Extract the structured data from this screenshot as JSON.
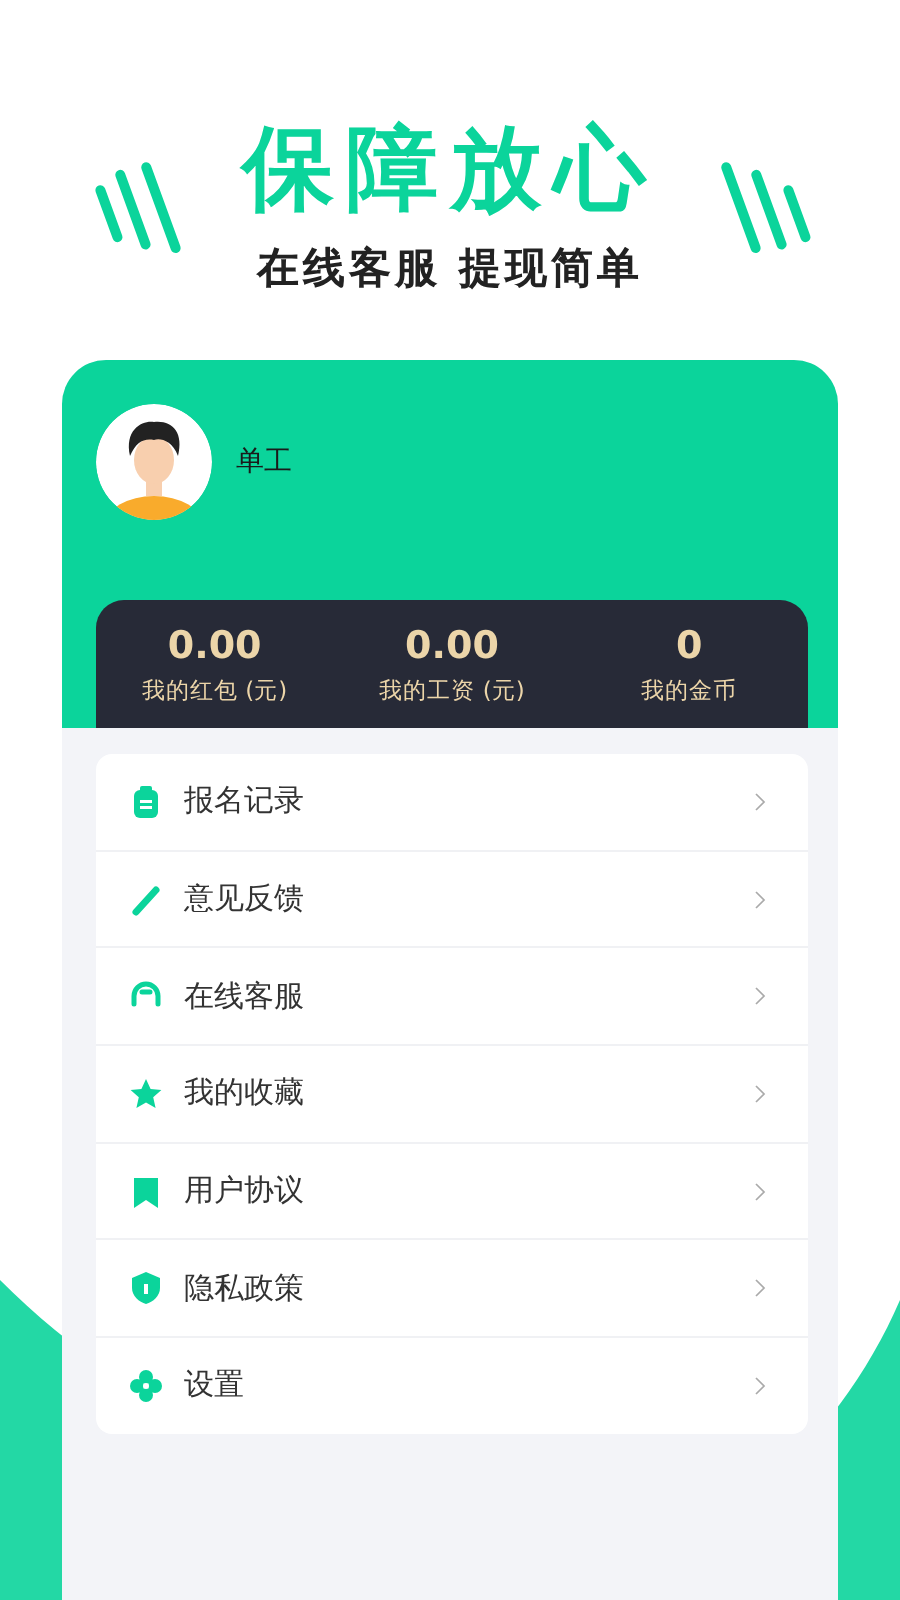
{
  "promo": {
    "headline": "保障放心",
    "subtitle": "在线客服 提现简单"
  },
  "profile": {
    "name": "单工"
  },
  "stats": [
    {
      "value": "0.00",
      "label": "我的红包 (元)"
    },
    {
      "value": "0.00",
      "label": "我的工资 (元)"
    },
    {
      "value": "0",
      "label": "我的金币"
    }
  ],
  "menu": [
    {
      "label": "报名记录"
    },
    {
      "label": "意见反馈"
    },
    {
      "label": "在线客服"
    },
    {
      "label": "我的收藏"
    },
    {
      "label": "用户协议"
    },
    {
      "label": "隐私政策"
    },
    {
      "label": "设置"
    }
  ]
}
